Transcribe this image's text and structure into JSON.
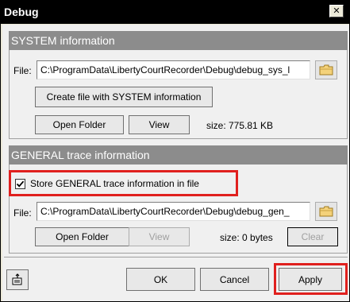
{
  "window": {
    "title": "Debug",
    "close_label": "✕"
  },
  "system": {
    "header": "SYSTEM information",
    "file_label": "File:",
    "file_path": "C:\\ProgramData\\LibertyCourtRecorder\\Debug\\debug_sys_l",
    "create_button": "Create file with SYSTEM information",
    "open_folder_button": "Open Folder",
    "view_button": "View",
    "size_text": "size: 775.81 KB"
  },
  "general": {
    "header": "GENERAL trace information",
    "store_checkbox_label": "Store GENERAL trace information in file",
    "store_checked": true,
    "file_label": "File:",
    "file_path": "C:\\ProgramData\\LibertyCourtRecorder\\Debug\\debug_gen_",
    "open_folder_button": "Open Folder",
    "view_button": "View",
    "size_text": "size: 0 bytes",
    "clear_button": "Clear"
  },
  "footer": {
    "ok_button": "OK",
    "cancel_button": "Cancel",
    "apply_button": "Apply"
  },
  "highlight_color": "#e0201e"
}
